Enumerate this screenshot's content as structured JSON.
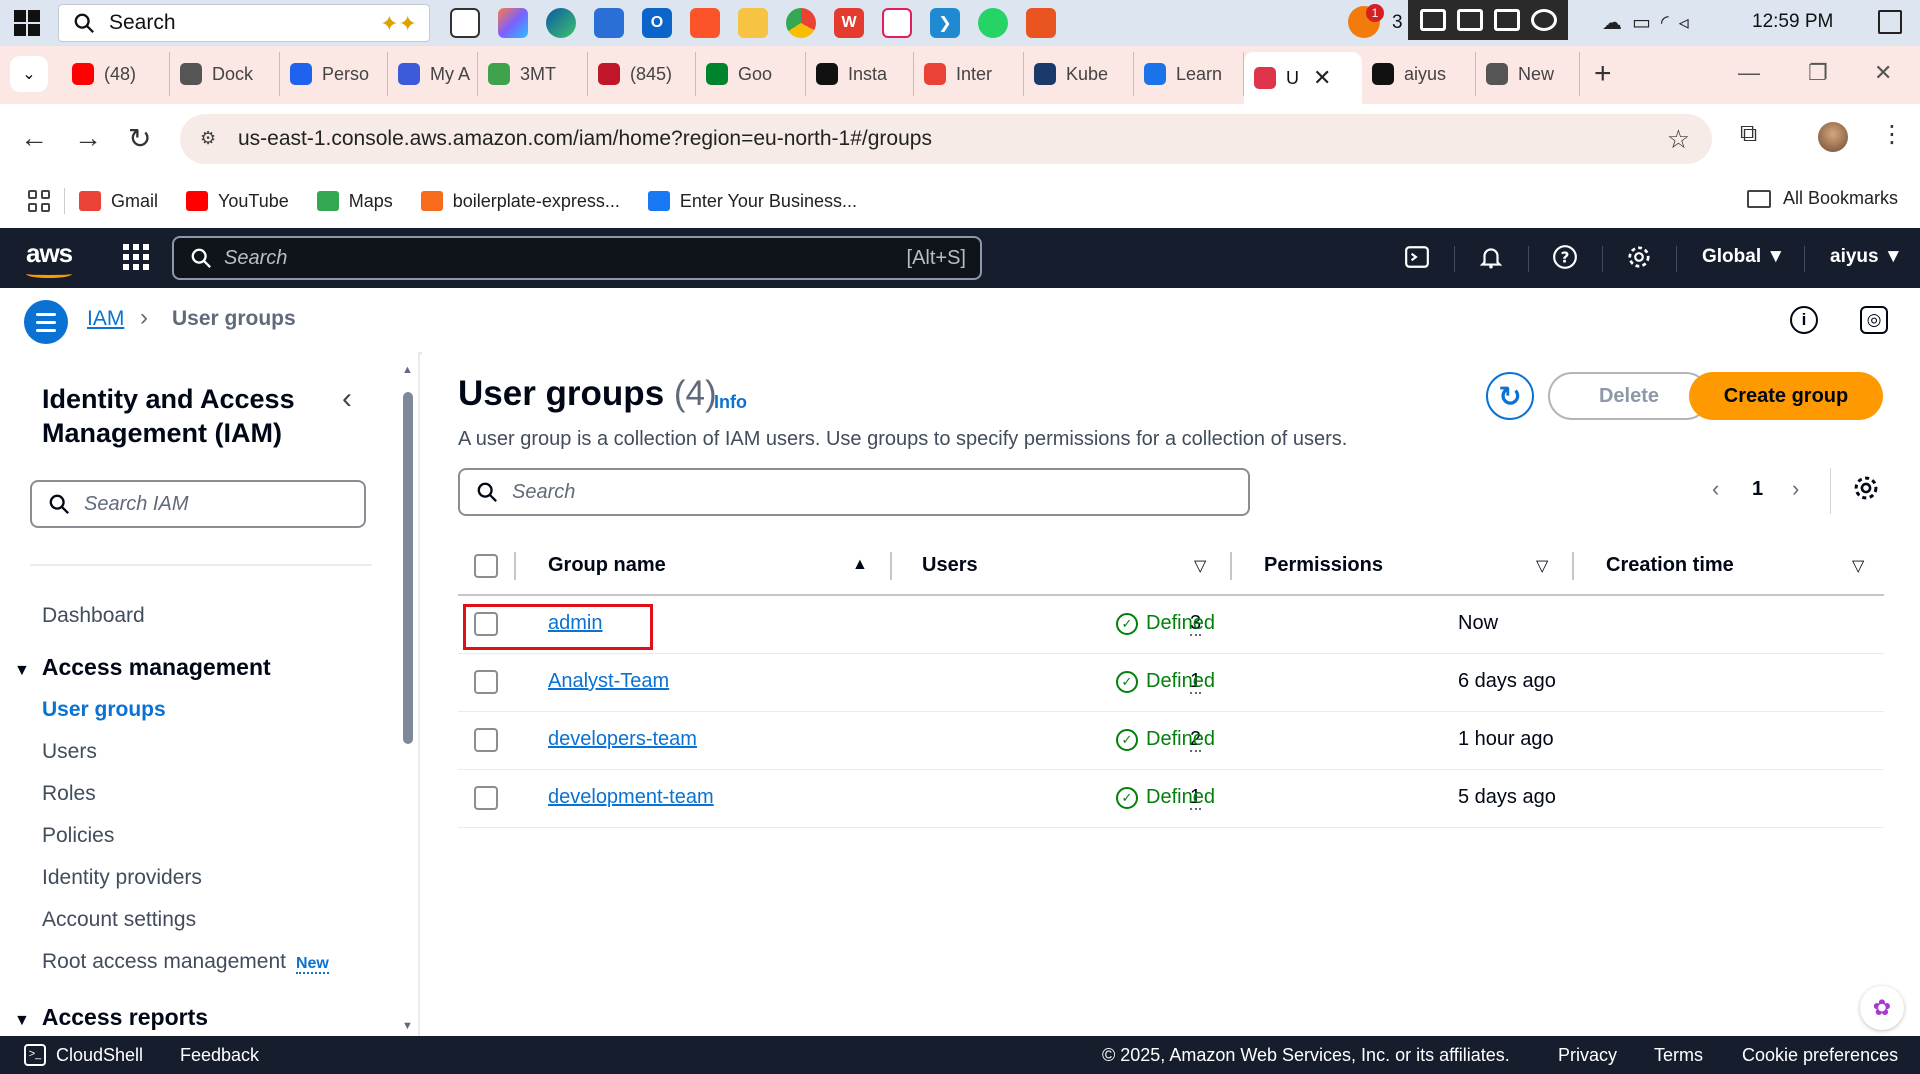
{
  "taskbar": {
    "search_placeholder": "Search",
    "notification_count": "1",
    "count_label": "3",
    "time": "12:59 PM"
  },
  "browser": {
    "tabs": [
      {
        "label": "(48)",
        "icon": "youtube-icon",
        "color": "#ff0000"
      },
      {
        "label": "Dock",
        "icon": "docker-icon",
        "color": "#555555"
      },
      {
        "label": "Perso",
        "icon": "docker-whale-icon",
        "color": "#1d63ed"
      },
      {
        "label": "My A",
        "icon": "document-icon",
        "color": "#3b5bdb"
      },
      {
        "label": "3MT",
        "icon": "grid-icon",
        "color": "#3fa34d"
      },
      {
        "label": "(845)",
        "icon": "badge-icon",
        "color": "#c0162a"
      },
      {
        "label": "Goo",
        "icon": "google-meet-icon",
        "color": "#00832d"
      },
      {
        "label": "Insta",
        "icon": "chatgpt-icon",
        "color": "#111111"
      },
      {
        "label": "Inter",
        "icon": "gmail-icon",
        "color": "#ea4335"
      },
      {
        "label": "Kube",
        "icon": "kube-icon",
        "color": "#1b3a6b"
      },
      {
        "label": "Learn",
        "icon": "learn-icon",
        "color": "#1a73e8"
      },
      {
        "label": "U",
        "icon": "aws-tab-icon",
        "color": "#dd344c",
        "active": true
      },
      {
        "label": "aiyus",
        "icon": "github-icon",
        "color": "#111111"
      },
      {
        "label": "New",
        "icon": "chrome-icon",
        "color": "#555555"
      }
    ],
    "url": "us-east-1.console.aws.amazon.com/iam/home?region=eu-north-1#/groups",
    "bookmarks": [
      {
        "label": "Gmail",
        "icon": "gmail-icon",
        "color": "#ea4335"
      },
      {
        "label": "YouTube",
        "icon": "youtube-icon",
        "color": "#ff0000"
      },
      {
        "label": "Maps",
        "icon": "maps-pin-icon",
        "color": "#34a853"
      },
      {
        "label": "boilerplate-express...",
        "icon": "freecodecamp-icon",
        "color": "#f76b1c"
      },
      {
        "label": "Enter Your Business...",
        "icon": "butterfly-icon",
        "color": "#1877f2"
      }
    ],
    "all_bookmarks": "All Bookmarks"
  },
  "aws": {
    "logo": "aws",
    "search_placeholder": "Search",
    "search_shortcut": "[Alt+S]",
    "region": "Global",
    "account": "aiyus"
  },
  "breadcrumb": {
    "root": "IAM",
    "current": "User groups"
  },
  "sidebar": {
    "title": "Identity and Access Management (IAM)",
    "search_placeholder": "Search IAM",
    "dashboard": "Dashboard",
    "section_access_management": "Access management",
    "items": [
      "User groups",
      "Users",
      "Roles",
      "Policies",
      "Identity providers",
      "Account settings",
      "Root access management"
    ],
    "new_badge": "New",
    "section_access_reports": "Access reports"
  },
  "main": {
    "title": "User groups",
    "count": "(4)",
    "info": "Info",
    "description": "A user group is a collection of IAM users. Use groups to specify permissions for a collection of users.",
    "delete_label": "Delete",
    "create_label": "Create group",
    "search_placeholder": "Search",
    "page": "1",
    "columns": {
      "group_name": "Group name",
      "users": "Users",
      "permissions": "Permissions",
      "creation_time": "Creation time"
    },
    "rows": [
      {
        "name": "admin",
        "users": "3",
        "permissions": "Defined",
        "created": "Now"
      },
      {
        "name": "Analyst-Team",
        "users": "1",
        "permissions": "Defined",
        "created": "6 days ago"
      },
      {
        "name": "developers-team",
        "users": "2",
        "permissions": "Defined",
        "created": "1 hour ago"
      },
      {
        "name": "development-team",
        "users": "1",
        "permissions": "Defined",
        "created": "5 days ago"
      }
    ]
  },
  "footer": {
    "cloudshell": "CloudShell",
    "feedback": "Feedback",
    "copyright": "© 2025, Amazon Web Services, Inc. or its affiliates.",
    "privacy": "Privacy",
    "terms": "Terms",
    "cookies": "Cookie preferences"
  },
  "colors": {
    "aws_nav": "#161e2d",
    "link_blue": "#0972d3",
    "primary_orange": "#ff9900",
    "success_green": "#037f0c",
    "highlight_red": "#e0101a"
  }
}
